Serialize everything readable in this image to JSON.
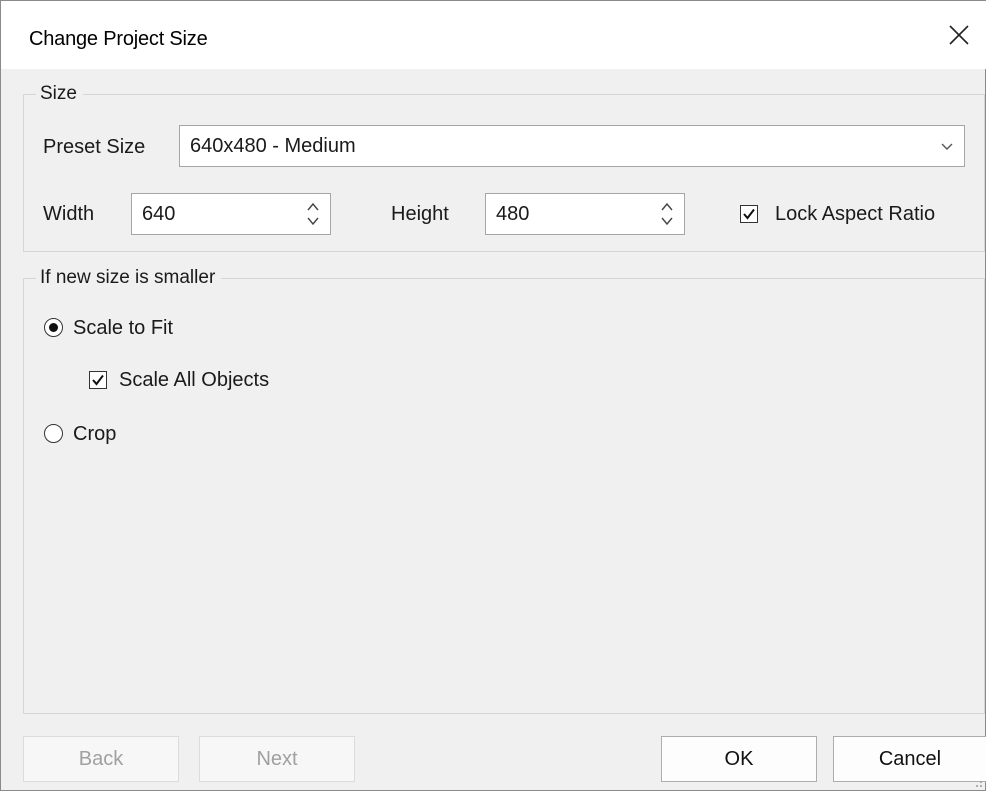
{
  "window": {
    "title": "Change Project Size",
    "close_icon": "close-icon"
  },
  "size_group": {
    "legend": "Size",
    "preset_label": "Preset Size",
    "preset_value": "640x480 - Medium",
    "width_label": "Width",
    "width_value": "640",
    "height_label": "Height",
    "height_value": "480",
    "lock_aspect_label": "Lock Aspect Ratio",
    "lock_aspect_checked": true
  },
  "smaller_group": {
    "legend": "If new size is smaller",
    "scale_to_fit_label": "Scale to Fit",
    "scale_to_fit_selected": true,
    "scale_all_objects_label": "Scale All Objects",
    "scale_all_objects_checked": true,
    "crop_label": "Crop",
    "crop_selected": false
  },
  "footer": {
    "back_label": "Back",
    "next_label": "Next",
    "ok_label": "OK",
    "cancel_label": "Cancel"
  }
}
